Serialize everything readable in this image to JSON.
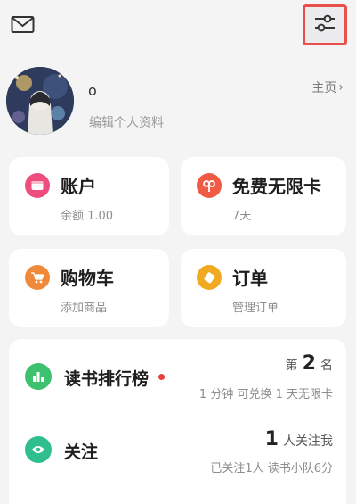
{
  "header": {
    "mail_icon": "mail-icon",
    "filter_icon": "sliders-icon"
  },
  "profile": {
    "nickname": "o",
    "edit_label": "编辑个人资料",
    "home_label": "主页",
    "home_chevron": "›"
  },
  "cards": {
    "account": {
      "title": "账户",
      "sub": "余额 1.00",
      "icon": "wallet-icon",
      "color": "#ee4e7e"
    },
    "vip": {
      "title": "免费无限卡",
      "sub": "7天",
      "icon": "card-icon",
      "color": "#ef5b45"
    },
    "cart": {
      "title": "购物车",
      "sub": "添加商品",
      "icon": "cart-icon",
      "color": "#f08a3a"
    },
    "order": {
      "title": "订单",
      "sub": "管理订单",
      "icon": "order-icon",
      "color": "#f2a922"
    }
  },
  "rank": {
    "title": "读书排行榜",
    "prefix": "第",
    "value": "2",
    "suffix": "名",
    "desc": "1 分钟 可兑换 1 天无限卡",
    "icon": "bar-chart-icon",
    "color": "#3cc26e"
  },
  "follow": {
    "title": "关注",
    "value": "1",
    "suffix": "人关注我",
    "desc": "已关注1人 读书小队6分",
    "icon": "eye-icon",
    "color": "#2fbf8f"
  }
}
